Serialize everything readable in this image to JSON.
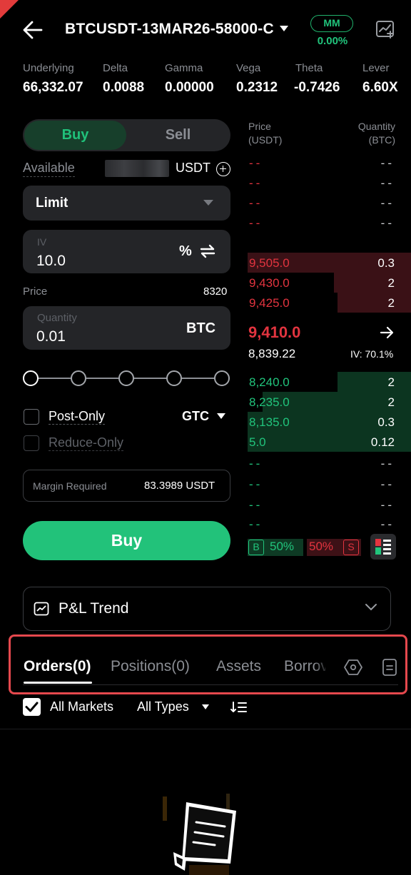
{
  "header": {
    "symbol": "BTCUSDT-13MAR26-58000-C",
    "mm_label": "MM",
    "mm_value": "0.00%"
  },
  "metrics": [
    {
      "label": "Underlying",
      "value": "66,332.07"
    },
    {
      "label": "Delta",
      "value": "0.0088"
    },
    {
      "label": "Gamma",
      "value": "0.00000"
    },
    {
      "label": "Vega",
      "value": "0.2312"
    },
    {
      "label": "Theta",
      "value": "-0.7426"
    },
    {
      "label": "Lever",
      "value": "6.60X"
    }
  ],
  "trade": {
    "buy_tab": "Buy",
    "sell_tab": "Sell",
    "available_label": "Available",
    "available_unit": "USDT",
    "order_type": "Limit",
    "iv_label": "IV",
    "iv_value": "10.0",
    "iv_unit": "%",
    "price_label": "Price",
    "price_value": "8320",
    "qty_label": "Quantity",
    "qty_value": "0.01",
    "qty_unit": "BTC",
    "slider_percent": 0,
    "post_only": "Post-Only",
    "reduce_only": "Reduce-Only",
    "tif": "GTC",
    "margin_label": "Margin Required",
    "margin_value": "83.3989 USDT",
    "buy_button": "Buy"
  },
  "orderbook": {
    "price_header": "Price",
    "price_header_unit": "(USDT)",
    "qty_header": "Quantity",
    "qty_header_unit": "(BTC)",
    "empty_price": "--",
    "empty_qty": "--",
    "asks": [
      {
        "price": "9,505.0",
        "qty": "0.3",
        "depth": 1.0
      },
      {
        "price": "9,430.0",
        "qty": "2",
        "depth": 0.47
      },
      {
        "price": "9,425.0",
        "qty": "2",
        "depth": 0.45
      }
    ],
    "last_price": "9,410.0",
    "mark_price": "8,839.22",
    "iv_readout": "IV: 70.1%",
    "bids": [
      {
        "price": "8,240.0",
        "qty": "2",
        "depth": 0.45
      },
      {
        "price": "8,235.0",
        "qty": "2",
        "depth": 0.91
      },
      {
        "price": "8,135.0",
        "qty": "0.3",
        "depth": 1.0
      },
      {
        "price": "5.0",
        "qty": "0.12",
        "depth": 1.0
      }
    ],
    "buy_letter": "B",
    "buy_ratio": "50%",
    "sell_ratio": "50%",
    "sell_letter": "S"
  },
  "pnl": {
    "label": "P&L Trend"
  },
  "tabs": [
    {
      "label": "Orders(0)"
    },
    {
      "label": "Positions(0)"
    },
    {
      "label": "Assets"
    },
    {
      "label": "Borrov"
    }
  ],
  "filters": {
    "all_markets": "All Markets",
    "all_types": "All Types"
  },
  "colors": {
    "buy_green": "#22c27a",
    "sell_red": "#e2343f",
    "highlight": "#e5484d"
  }
}
